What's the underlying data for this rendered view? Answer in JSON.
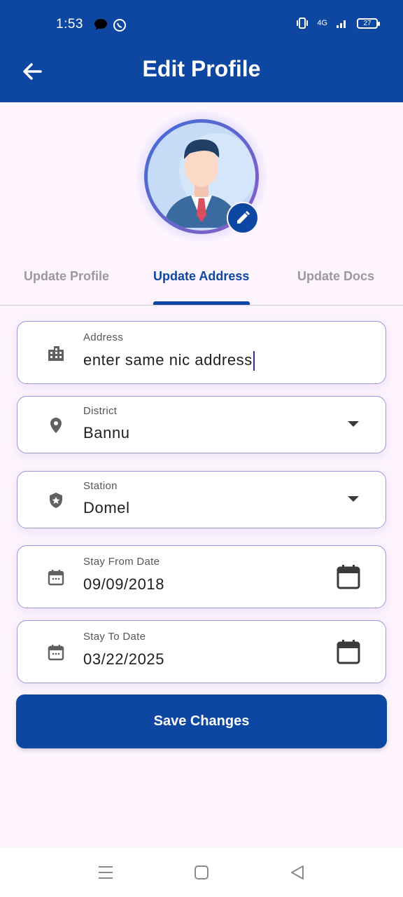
{
  "status_bar": {
    "time": "1:53",
    "network": "4G",
    "battery": "27"
  },
  "header": {
    "title": "Edit Profile"
  },
  "tabs": [
    {
      "label": "Update Profile",
      "active": false
    },
    {
      "label": "Update Address",
      "active": true
    },
    {
      "label": "Update Docs",
      "active": false
    }
  ],
  "form": {
    "address": {
      "label": "Address",
      "value": "enter same nic address"
    },
    "district": {
      "label": "District",
      "value": "Bannu"
    },
    "station": {
      "label": "Station",
      "value": "Domel"
    },
    "stay_from": {
      "label": "Stay From Date",
      "value": "09/09/2018"
    },
    "stay_to": {
      "label": "Stay To Date",
      "value": "03/22/2025"
    }
  },
  "actions": {
    "save_label": "Save Changes"
  },
  "colors": {
    "primary": "#0d47a1",
    "background": "#fdf4fd",
    "field_border": "#9b97d8",
    "inactive_tab": "#9a9a9a"
  },
  "icons": [
    "back-arrow-icon",
    "edit-pencil-icon",
    "building-icon",
    "location-pin-icon",
    "shield-star-icon",
    "calendar-icon",
    "dropdown-arrow-icon",
    "menu-icon",
    "home-square-icon",
    "back-triangle-icon"
  ]
}
